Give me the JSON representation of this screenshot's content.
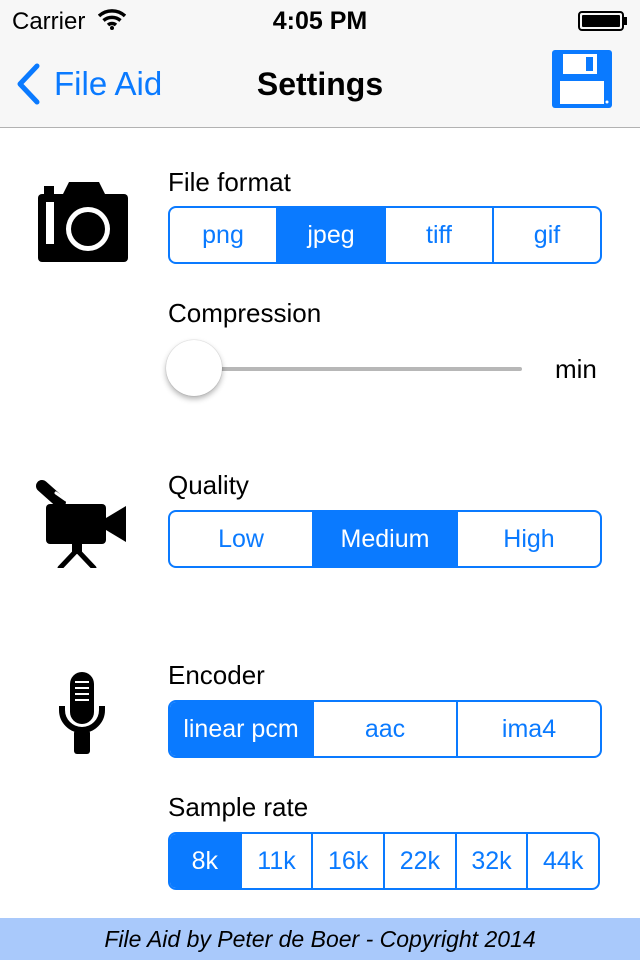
{
  "status_bar": {
    "carrier": "Carrier",
    "time": "4:05 PM"
  },
  "nav": {
    "back_label": "File Aid",
    "title": "Settings"
  },
  "image": {
    "file_format_label": "File format",
    "file_format_options": [
      "png",
      "jpeg",
      "tiff",
      "gif"
    ],
    "file_format_selected": "jpeg",
    "compression_label": "Compression",
    "compression_value": "min",
    "compression_level": 0
  },
  "video": {
    "quality_label": "Quality",
    "quality_options": [
      "Low",
      "Medium",
      "High"
    ],
    "quality_selected": "Medium"
  },
  "audio": {
    "encoder_label": "Encoder",
    "encoder_options": [
      "linear pcm",
      "aac",
      "ima4"
    ],
    "encoder_selected": "linear pcm",
    "sample_rate_label": "Sample rate",
    "sample_rate_options": [
      "8k",
      "11k",
      "16k",
      "22k",
      "32k",
      "44k"
    ],
    "sample_rate_selected": "8k"
  },
  "footer": {
    "text": "File Aid by Peter de Boer - Copyright 2014"
  },
  "colors": {
    "accent": "#0a7aff",
    "footer_bg": "#a9c9fb",
    "bar_bg": "#f7f7f7"
  },
  "icons": {
    "back": "chevron-left-icon",
    "save": "floppy-disk-icon",
    "image_section": "camera-icon",
    "video_section": "video-camera-icon",
    "audio_section": "microphone-icon"
  }
}
